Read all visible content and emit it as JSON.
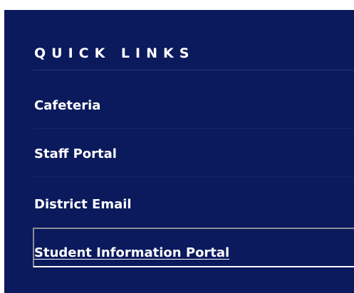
{
  "quick_links": {
    "heading": "QUICK LINKS",
    "items": [
      {
        "label": "Cafeteria"
      },
      {
        "label": "Staff Portal"
      },
      {
        "label": "District Email"
      },
      {
        "label": "Student Information Portal",
        "focused": true
      }
    ]
  },
  "colors": {
    "panel_background": "#0b1a5c",
    "text": "#ffffff"
  }
}
